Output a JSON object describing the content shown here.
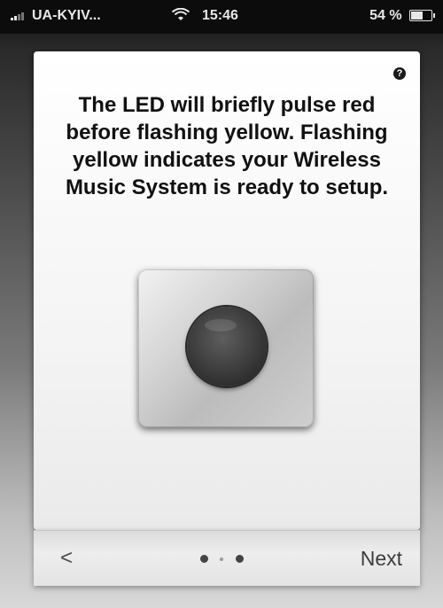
{
  "status_bar": {
    "carrier": "UA-KYIV...",
    "time": "15:46",
    "battery": "54 %",
    "battery_level": 0.54,
    "icons": [
      "signal-icon",
      "wifi-icon",
      "battery-icon"
    ]
  },
  "card": {
    "help_symbol": "?",
    "instruction": "The LED will briefly pulse red before flashing yellow. Flashing yellow indicates your Wireless Music System is ready to setup."
  },
  "nav": {
    "back_symbol": "<",
    "next_label": "Next",
    "page_count": 3,
    "current_page": 1
  }
}
